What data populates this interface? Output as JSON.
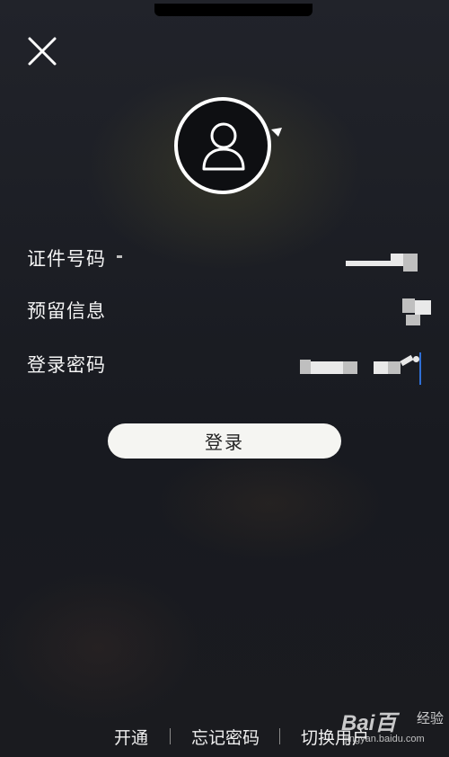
{
  "form": {
    "fields": [
      {
        "label": "证件号码",
        "value_masked": true
      },
      {
        "label": "预留信息",
        "value_masked": true
      },
      {
        "label": "登录密码",
        "value_masked": true
      }
    ],
    "login_label": "登录"
  },
  "footer": {
    "links": [
      "开通",
      "忘记密码",
      "切换用户"
    ]
  },
  "watermark": {
    "brand": "Bai百",
    "name": "经验",
    "url": "jingyan.baidu.com"
  },
  "icons": {
    "close": "close-icon",
    "avatar": "user-avatar-icon"
  },
  "colors": {
    "background": "#1b1e26",
    "button_bg": "#f5f5f2",
    "cursor": "#2f6fd6",
    "text": "#f4f4f4"
  }
}
